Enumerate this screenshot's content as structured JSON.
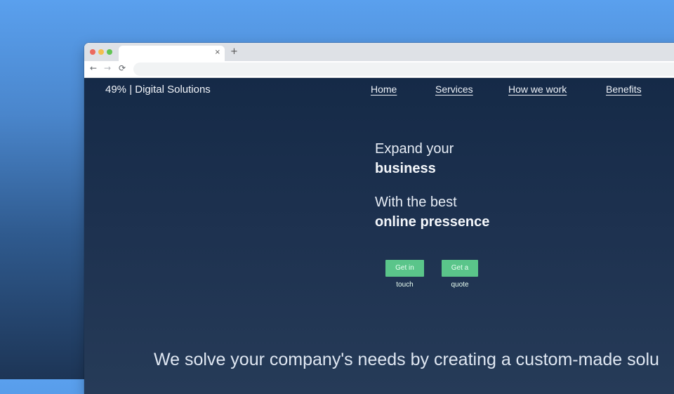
{
  "browser": {
    "tab_close_icon": "×",
    "new_tab_icon": "+",
    "back_icon": "←",
    "forward_icon": "→",
    "reload_icon": "⟳"
  },
  "site": {
    "logo": "49% | Digital Solutions",
    "nav": {
      "home": "Home",
      "services": "Services",
      "how_we_work": "How we work",
      "benefits": "Benefits"
    },
    "hero": {
      "line1": "Expand your",
      "line2": "business",
      "line3": "With the best",
      "line4": "online pressence"
    },
    "cta": {
      "get_in_touch": "Get in touch",
      "get_a_quote": "Get a quote"
    },
    "tagline": "We solve your company's needs by creating a custom-made solu"
  },
  "colors": {
    "page_bg_top": "#152a47",
    "page_bg_bottom": "#263b58",
    "accent_button": "#5ac58a"
  }
}
